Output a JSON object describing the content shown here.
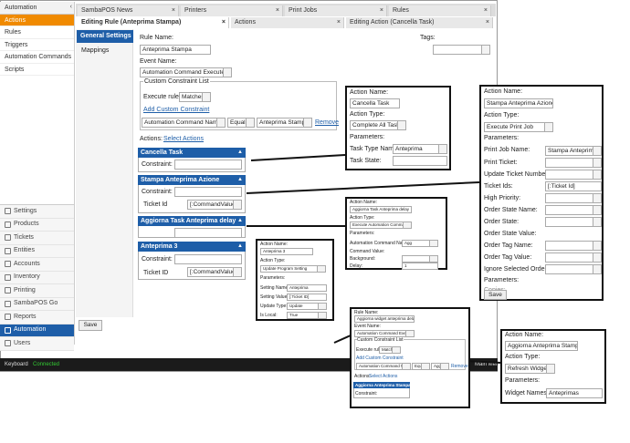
{
  "sidebar": {
    "header": "Automation",
    "items": [
      "Actions",
      "Rules",
      "Triggers",
      "Automation Commands",
      "Scripts"
    ]
  },
  "nav": {
    "items": [
      "Settings",
      "Products",
      "Tickets",
      "Entities",
      "Accounts",
      "Inventory",
      "Printing",
      "SambaPOS Go",
      "Reports",
      "Automation",
      "Users"
    ]
  },
  "tabs": [
    "SambaPOS News",
    "Printers",
    "Print Jobs",
    "Rules",
    "Editing Rule (Anteprima Stampa)",
    "Actions",
    "Editing Action (Cancella Task)"
  ],
  "rule": {
    "general_settings": "General Settings",
    "mappings": "Mappings",
    "rule_name_label": "Rule Name:",
    "rule_name": "Anteprima Stampa",
    "tags_label": "Tags:",
    "event_name_label": "Event Name:",
    "event_name": "Automation Command Executed",
    "ccl_title": "Custom Constraint List",
    "execute_rule_if": "Execute rule if",
    "matches": "Matches",
    "add_constraint": "Add Custom Constraint",
    "c_field": "Automation Command Name",
    "c_op": "Equals",
    "c_val": "Anteprima Stampa",
    "remove": "Remove",
    "actions_label": "Actions:",
    "select_actions": "Select Actions",
    "constraint": "Constraint:",
    "ticket_id": "Ticket Id",
    "ticket_id_alt": "Ticket ID",
    "cmd_value": "[:CommandValue]",
    "save": "Save"
  },
  "action_cards": [
    "Cancella Task",
    "Stampa Anteprima Azione",
    "Aggiorna Task Anteprima delay",
    "Anteprima 3"
  ],
  "p1": {
    "action_name_label": "Action Name:",
    "action_name": "Cancella Task",
    "action_type_label": "Action Type:",
    "action_type": "Complete All Tasks",
    "parameters": "Parameters:",
    "task_type_label": "Task Type Name:",
    "task_type": "Anteprima",
    "task_state_label": "Task State:"
  },
  "p2": {
    "action_name_label": "Action Name:",
    "action_name": "Stampa Anteprima Azione",
    "action_type_label": "Action Type:",
    "action_type": "Execute Print Job",
    "parameters": "Parameters:",
    "rows": [
      "Print Job Name:",
      "Print Ticket:",
      "Update Ticket Number:",
      "Ticket Ids:",
      "High Priority:",
      "Order State Name:",
      "Order State:",
      "Order State Value:",
      "Order Tag Name:",
      "Order Tag Value:",
      "Ignore Selected Orders:",
      "Parameters:",
      "Copies:"
    ],
    "print_job": "Stampa Anteprima Job",
    "ticket_ids": "[:Ticket Id]",
    "save": "Save"
  },
  "p3": {
    "rows": [
      "Action Name:",
      "Aggiorna Task Anteprima delay",
      "Action Type:",
      "Execute Automation Command",
      "Parameters:",
      "Automation Command Name:",
      "Command Value:",
      "Background:",
      "Delay:"
    ],
    "cmd": "Agg",
    "delay": "1"
  },
  "p4": {
    "rows": [
      "Action Name:",
      "Anteprima 3",
      "Action Type:",
      "Update Program Setting",
      "Parameters:",
      "Setting Name:",
      "Setting Value:",
      "Update Type:",
      "Is Local:"
    ],
    "setting_name": "Anteprima",
    "setting_value": "[:Ticket ID]",
    "update_type": "Update",
    "is_local": "True"
  },
  "p5": {
    "rule_name_label": "Rule Name:",
    "rule_name": "Aggiorna widget anteprima delay",
    "event_label": "Event Name:",
    "event": "Automation Command Executed",
    "ccl": "Custom Constraint List",
    "exec": "Execute rule if",
    "matches": "Matches",
    "add": "Add Custom Constraint",
    "field": "Automation Command Name",
    "op": "Equals",
    "val": "Agg",
    "remove": "Remove",
    "actions": "Actions:",
    "select": "Select Actions",
    "card": "Aggiorna Anteprima Stampa",
    "constraint": "Constraint:"
  },
  "p6": {
    "action_name_label": "Action Name:",
    "action_name": "Aggiorna Anteprima Stampa",
    "action_type_label": "Action Type:",
    "action_type": "Refresh Widgets",
    "parameters": "Parameters:",
    "widget_label": "Widget Names:",
    "widget": "Anteprimas"
  },
  "status": {
    "keyboard": "Keyboard",
    "connected": "Connected",
    "main_menu": "Main Menu"
  }
}
